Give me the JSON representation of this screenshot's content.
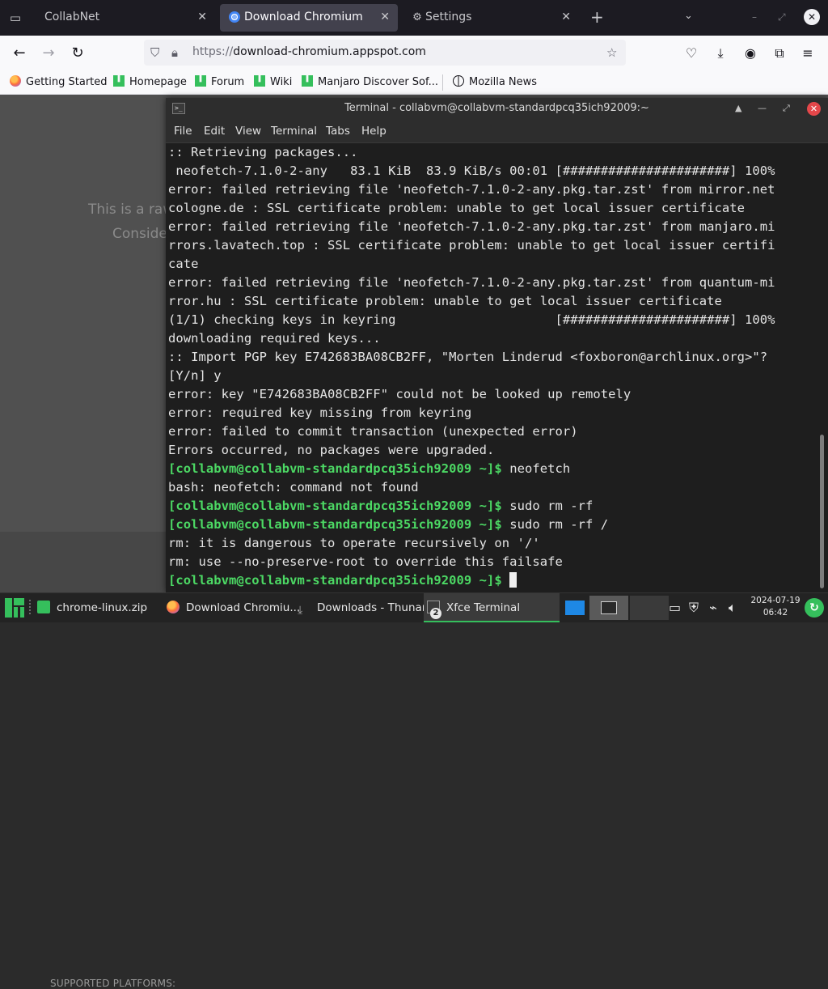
{
  "browser": {
    "tabs": [
      {
        "label": "CollabNet",
        "active": false
      },
      {
        "label": "Download Chromium",
        "active": true
      },
      {
        "label": "Settings",
        "active": false
      }
    ],
    "url": {
      "protocol": "https://",
      "host": "download-chromium.appspot.com"
    },
    "bookmarks": [
      {
        "label": "Getting Started",
        "icon": "firefox-icon"
      },
      {
        "label": "Homepage",
        "icon": "manjaro-icon"
      },
      {
        "label": "Forum",
        "icon": "manjaro-icon"
      },
      {
        "label": "Wiki",
        "icon": "manjaro-icon"
      },
      {
        "label": "Manjaro Discover Sof...",
        "icon": "manjaro-icon"
      },
      {
        "label": "Mozilla News",
        "icon": "globe-icon"
      }
    ]
  },
  "webpage": {
    "text1": "This is a raw",
    "text2": "Conside",
    "platforms_label": "SUPPORTED PLATFORMS:"
  },
  "terminal": {
    "title": "Terminal - collabvm@collabvm-standardpcq35ich92009:~",
    "menu": [
      "File",
      "Edit",
      "View",
      "Terminal",
      "Tabs",
      "Help"
    ],
    "lines": [
      {
        "text": ":: Retrieving packages..."
      },
      {
        "text": " neofetch-7.1.0-2-any   83.1 KiB  83.9 KiB/s 00:01 [######################] 100%"
      },
      {
        "text": "error: failed retrieving file 'neofetch-7.1.0-2-any.pkg.tar.zst' from mirror.net"
      },
      {
        "text": "cologne.de : SSL certificate problem: unable to get local issuer certificate"
      },
      {
        "text": "error: failed retrieving file 'neofetch-7.1.0-2-any.pkg.tar.zst' from manjaro.mi"
      },
      {
        "text": "rrors.lavatech.top : SSL certificate problem: unable to get local issuer certifi"
      },
      {
        "text": "cate"
      },
      {
        "text": "error: failed retrieving file 'neofetch-7.1.0-2-any.pkg.tar.zst' from quantum-mi"
      },
      {
        "text": "rror.hu : SSL certificate problem: unable to get local issuer certificate"
      },
      {
        "text": "(1/1) checking keys in keyring                     [######################] 100%"
      },
      {
        "text": "downloading required keys..."
      },
      {
        "text": ":: Import PGP key E742683BA08CB2FF, \"Morten Linderud <foxboron@archlinux.org>\"?"
      },
      {
        "text": "[Y/n] y"
      },
      {
        "text": "error: key \"E742683BA08CB2FF\" could not be looked up remotely"
      },
      {
        "text": "error: required key missing from keyring"
      },
      {
        "text": "error: failed to commit transaction (unexpected error)"
      },
      {
        "text": "Errors occurred, no packages were upgraded."
      },
      {
        "prompt": "[collabvm@collabvm-standardpcq35ich92009 ~]$",
        "text": " neofetch"
      },
      {
        "text": "bash: neofetch: command not found"
      },
      {
        "prompt": "[collabvm@collabvm-standardpcq35ich92009 ~]$",
        "text": " sudo rm -rf"
      },
      {
        "prompt": "[collabvm@collabvm-standardpcq35ich92009 ~]$",
        "text": " sudo rm -rf /"
      },
      {
        "text": "rm: it is dangerous to operate recursively on '/'"
      },
      {
        "text": "rm: use --no-preserve-root to override this failsafe"
      },
      {
        "prompt": "[collabvm@collabvm-standardpcq35ich92009 ~]$",
        "text": " ",
        "cursor": true
      }
    ]
  },
  "taskbar": {
    "items": [
      {
        "label": "chrome-linux.zip"
      },
      {
        "label": "Download Chromiu..."
      },
      {
        "label": "Downloads - Thunar"
      },
      {
        "label": "Xfce Terminal"
      }
    ],
    "terminal_group_count": "2",
    "clock_date": "2024-07-19",
    "clock_time": "06:42"
  },
  "colors": {
    "prompt": "#4cd964",
    "accent": "#35bf5c",
    "terminal_bg": "#1e1e1e"
  }
}
